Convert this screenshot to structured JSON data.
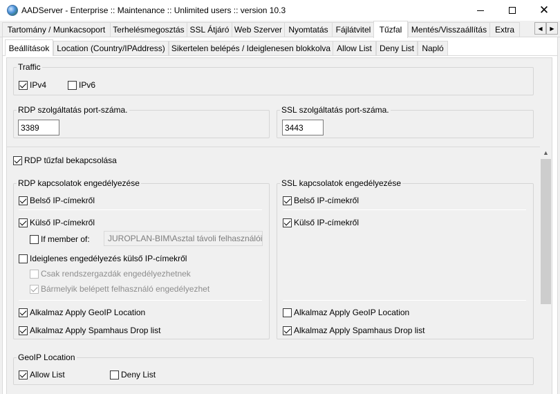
{
  "window": {
    "title": "AADServer - Enterprise :: Maintenance :: Unlimited users :: version 10.3"
  },
  "main_tabs": [
    {
      "label": "Tartomány / Munkacsoport"
    },
    {
      "label": "Terhelésmegosztás"
    },
    {
      "label": "SSL Átjáró"
    },
    {
      "label": "Web Szerver"
    },
    {
      "label": "Nyomtatás"
    },
    {
      "label": "Fájlátvitel"
    },
    {
      "label": "Tűzfal"
    },
    {
      "label": "Mentés/Visszaállítás"
    },
    {
      "label": "Extra"
    }
  ],
  "main_tabs_active": "Tűzfal",
  "sub_tabs": [
    {
      "label": "Beállítások"
    },
    {
      "label": "Location (Country/IPAddress)"
    },
    {
      "label": "Sikertelen belépés / Ideiglenesen blokkolva"
    },
    {
      "label": "Allow List"
    },
    {
      "label": "Deny List"
    },
    {
      "label": "Napló"
    }
  ],
  "traffic": {
    "title": "Traffic",
    "ipv4": {
      "label": "IPv4",
      "checked": true
    },
    "ipv6": {
      "label": "IPv6",
      "checked": false
    }
  },
  "rdp_port": {
    "title": "RDP szolgáltatás port-száma.",
    "value": "3389"
  },
  "ssl_port": {
    "title": "SSL szolgáltatás port-száma.",
    "value": "3443"
  },
  "rdp_firewall_enable": {
    "label": "RDP tűzfal bekapcsolása",
    "checked": true
  },
  "rdp_group": {
    "title": "RDP kapcsolatok engedélyezése",
    "internal": {
      "label": "Belső IP-címekről",
      "checked": true
    },
    "external": {
      "label": "Külső IP-címekről",
      "checked": true
    },
    "if_member": {
      "label": "If member of:",
      "checked": false,
      "value": "JUROPLAN-BIM\\Asztal távoli felhasználói"
    },
    "temporary": {
      "label": "Ideiglenes engedélyezés külső IP-címekről",
      "checked": false
    },
    "admins_only": {
      "label": "Csak rendszergazdák engedélyezhetnek",
      "checked": false
    },
    "any_user": {
      "label": "Bármelyik belépett felhasználó engedélyezhet",
      "checked": true
    },
    "geoip": {
      "label": "Alkalmaz Apply GeoIP Location",
      "checked": true
    },
    "spamhaus": {
      "label": "Alkalmaz Apply Spamhaus Drop list",
      "checked": true
    }
  },
  "ssl_group": {
    "title": "SSL kapcsolatok engedélyezése",
    "internal": {
      "label": "Belső IP-címekről",
      "checked": true
    },
    "external": {
      "label": "Külső IP-címekről",
      "checked": true
    },
    "geoip": {
      "label": "Alkalmaz Apply GeoIP Location",
      "checked": false
    },
    "spamhaus": {
      "label": "Alkalmaz Apply Spamhaus Drop list",
      "checked": true
    }
  },
  "geoip_group": {
    "title": "GeoIP Location",
    "allow": {
      "label": "Allow List",
      "checked": true
    },
    "deny": {
      "label": "Deny List",
      "checked": false
    }
  }
}
